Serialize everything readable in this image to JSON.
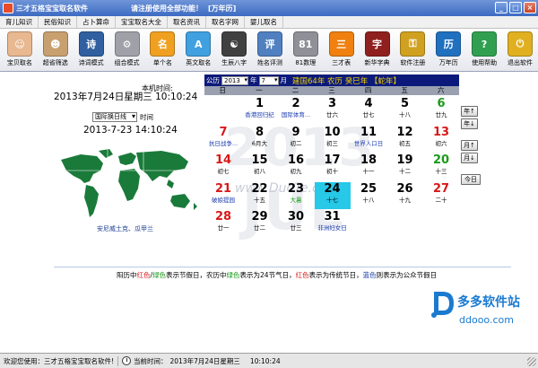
{
  "window": {
    "title": "三才五格宝宝取名软件",
    "notice": "请注册使用全部功能！",
    "mode": "[万年历]",
    "buttons": [
      "_",
      "□",
      "×"
    ]
  },
  "menu": [
    "育儿知识",
    "民俗知识",
    "占卜算命",
    "宝宝取名大全",
    "取名资讯",
    "取名字网",
    "婴儿取名"
  ],
  "toolbar": [
    {
      "label": "宝贝取名",
      "icon": "baby-face-icon",
      "color": "#e8b890",
      "glyph": "☺"
    },
    {
      "label": "超省筛选",
      "icon": "baby-filter-icon",
      "color": "#c8a070",
      "glyph": "☻"
    },
    {
      "label": "诗词模式",
      "icon": "poetry-book-icon",
      "color": "#3060a0",
      "glyph": "诗"
    },
    {
      "label": "组合模式",
      "icon": "gears-icon",
      "color": "#a0a0a8",
      "glyph": "⚙"
    },
    {
      "label": "单个名",
      "icon": "single-name-icon",
      "color": "#f0a020",
      "glyph": "名"
    },
    {
      "label": "英文取名",
      "icon": "english-name-icon",
      "color": "#40a0e0",
      "glyph": "A"
    },
    {
      "label": "生辰八字",
      "icon": "yin-yang-icon",
      "color": "#404040",
      "glyph": "☯"
    },
    {
      "label": "姓名评测",
      "icon": "name-test-icon",
      "color": "#5080c0",
      "glyph": "评"
    },
    {
      "label": "81数理",
      "icon": "numerology-icon",
      "color": "#909098",
      "glyph": "81"
    },
    {
      "label": "三才表",
      "icon": "sancai-table-icon",
      "color": "#f08010",
      "glyph": "三"
    },
    {
      "label": "新华字典",
      "icon": "dictionary-icon",
      "color": "#902020",
      "glyph": "字"
    },
    {
      "label": "软件注册",
      "icon": "register-key-icon",
      "color": "#d0a020",
      "glyph": "⚿"
    },
    {
      "label": "万年历",
      "icon": "calendar-icon",
      "color": "#2070c0",
      "glyph": "历"
    },
    {
      "label": "使用帮助",
      "icon": "help-icon",
      "color": "#30a050",
      "glyph": "?"
    },
    {
      "label": "退出软件",
      "icon": "exit-icon",
      "color": "#e0b020",
      "glyph": "⏻"
    }
  ],
  "clock": {
    "local_label": "本机时间:",
    "local_time": "2013年7月24日星期三  10:10:24",
    "timezone_value": "国际换日线",
    "timezone_suffix": "时间",
    "world_time": "2013-7-23 14:10:24",
    "location": "安尼威土克、瓜甲兰"
  },
  "calendar": {
    "label_gongli": "公历",
    "year": "2013",
    "label_year": "年",
    "month": "7",
    "label_month": "月",
    "lunar_info": "建国64年  农历 癸巳年  【蛇年】",
    "weekdays": [
      "日",
      "一",
      "二",
      "三",
      "四",
      "五",
      "六"
    ],
    "days": [
      {
        "d": "1",
        "sub": "香港回归纪",
        "dc": "black",
        "sc": "blue",
        "col": 1,
        "row": 0
      },
      {
        "d": "2",
        "sub": "国际体育...",
        "dc": "black",
        "sc": "blue",
        "col": 2,
        "row": 0
      },
      {
        "d": "3",
        "sub": "廿六",
        "dc": "black",
        "sc": "black",
        "col": 3,
        "row": 0
      },
      {
        "d": "4",
        "sub": "廿七",
        "dc": "black",
        "sc": "black",
        "col": 4,
        "row": 0
      },
      {
        "d": "5",
        "sub": "十八",
        "dc": "black",
        "sc": "black",
        "col": 5,
        "row": 0
      },
      {
        "d": "6",
        "sub": "廿九",
        "dc": "green",
        "sc": "black",
        "col": 6,
        "row": 0
      },
      {
        "d": "7",
        "sub": "抗日战争...",
        "dc": "red",
        "sc": "blue",
        "col": 0,
        "row": 1
      },
      {
        "d": "8",
        "sub": "6月大",
        "dc": "black",
        "sc": "black",
        "col": 1,
        "row": 1
      },
      {
        "d": "9",
        "sub": "初二",
        "dc": "black",
        "sc": "black",
        "col": 2,
        "row": 1
      },
      {
        "d": "10",
        "sub": "初三",
        "dc": "black",
        "sc": "black",
        "col": 3,
        "row": 1
      },
      {
        "d": "11",
        "sub": "世界人口日",
        "dc": "black",
        "sc": "blue",
        "col": 4,
        "row": 1
      },
      {
        "d": "12",
        "sub": "初五",
        "dc": "black",
        "sc": "black",
        "col": 5,
        "row": 1
      },
      {
        "d": "13",
        "sub": "初六",
        "dc": "red",
        "sc": "black",
        "col": 6,
        "row": 1
      },
      {
        "d": "14",
        "sub": "初七",
        "dc": "red",
        "sc": "black",
        "col": 0,
        "row": 2
      },
      {
        "d": "15",
        "sub": "初八",
        "dc": "black",
        "sc": "black",
        "col": 1,
        "row": 2
      },
      {
        "d": "16",
        "sub": "初九",
        "dc": "black",
        "sc": "black",
        "col": 2,
        "row": 2
      },
      {
        "d": "17",
        "sub": "初十",
        "dc": "black",
        "sc": "black",
        "col": 3,
        "row": 2
      },
      {
        "d": "18",
        "sub": "十一",
        "dc": "black",
        "sc": "black",
        "col": 4,
        "row": 2
      },
      {
        "d": "19",
        "sub": "十二",
        "dc": "black",
        "sc": "black",
        "col": 5,
        "row": 2
      },
      {
        "d": "20",
        "sub": "十三",
        "dc": "green",
        "sc": "black",
        "col": 6,
        "row": 2
      },
      {
        "d": "21",
        "sub": "破娘提园",
        "dc": "red",
        "sc": "blue",
        "col": 0,
        "row": 3
      },
      {
        "d": "22",
        "sub": "十五",
        "dc": "black",
        "sc": "black",
        "col": 1,
        "row": 3
      },
      {
        "d": "23",
        "sub": "大暑",
        "dc": "black",
        "sc": "green",
        "col": 2,
        "row": 3
      },
      {
        "d": "24",
        "sub": "十七",
        "dc": "black",
        "sc": "black",
        "col": 3,
        "row": 3,
        "today": true
      },
      {
        "d": "25",
        "sub": "十八",
        "dc": "black",
        "sc": "black",
        "col": 4,
        "row": 3
      },
      {
        "d": "26",
        "sub": "十九",
        "dc": "black",
        "sc": "black",
        "col": 5,
        "row": 3
      },
      {
        "d": "27",
        "sub": "二十",
        "dc": "red",
        "sc": "black",
        "col": 6,
        "row": 3
      },
      {
        "d": "28",
        "sub": "廿一",
        "dc": "red",
        "sc": "black",
        "col": 0,
        "row": 4
      },
      {
        "d": "29",
        "sub": "廿二",
        "dc": "black",
        "sc": "black",
        "col": 1,
        "row": 4
      },
      {
        "d": "30",
        "sub": "廿三",
        "dc": "black",
        "sc": "black",
        "col": 2,
        "row": 4
      },
      {
        "d": "31",
        "sub": "非洲妇女日",
        "dc": "black",
        "sc": "blue",
        "col": 3,
        "row": 4
      }
    ],
    "watermark_year": "2013",
    "watermark_month": "JUL",
    "watermark_site": "www.DuoTe.com",
    "nav": {
      "prev_year": "年↑",
      "next_year": "年↓",
      "prev_month": "月↑",
      "next_month": "月↓",
      "today": "今日"
    }
  },
  "legend": {
    "p1": "阳历中",
    "red1": "红色",
    "p2": "/",
    "green1": "绿色",
    "p3": "表示节假日，农历中",
    "green2": "绿色",
    "p4": "表示为24节气日，",
    "red2": "红色",
    "p5": "表示为传统节日，",
    "blue1": "蓝色",
    "p6": "则表示为公众节假日"
  },
  "brand": {
    "name": "多多软件站",
    "url": "ddooo.com"
  },
  "status": {
    "welcome": "欢迎您使用：三才五格宝宝取名软件!",
    "current_label": "当前时间：",
    "current_time": "2013年7月24日星期三",
    "current_clock": "10:10:24"
  },
  "colors": {
    "title_bar": "#3d6bc2",
    "calendar_header": "#0b1a7a",
    "today_highlight": "#27c8e8",
    "holiday_red": "#d81818",
    "term_green": "#1a9a1a",
    "public_blue": "#1a3db0",
    "map_green": "#1a7a3a"
  }
}
